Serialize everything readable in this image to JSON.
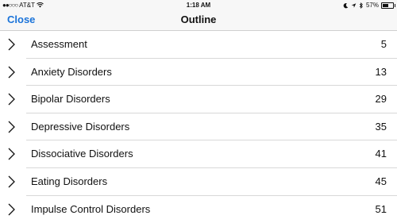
{
  "status_bar": {
    "carrier": "AT&T",
    "signal_dots": "●●○○○",
    "time": "1:18 AM",
    "battery": "57%",
    "battery_level": 0.57
  },
  "nav": {
    "close_label": "Close",
    "title": "Outline"
  },
  "outline": [
    {
      "label": "Assessment",
      "page": "5"
    },
    {
      "label": "Anxiety Disorders",
      "page": "13"
    },
    {
      "label": "Bipolar Disorders",
      "page": "29"
    },
    {
      "label": "Depressive Disorders",
      "page": "35"
    },
    {
      "label": "Dissociative Disorders",
      "page": "41"
    },
    {
      "label": "Eating Disorders",
      "page": "45"
    },
    {
      "label": "Impulse Control Disorders",
      "page": "51"
    }
  ]
}
